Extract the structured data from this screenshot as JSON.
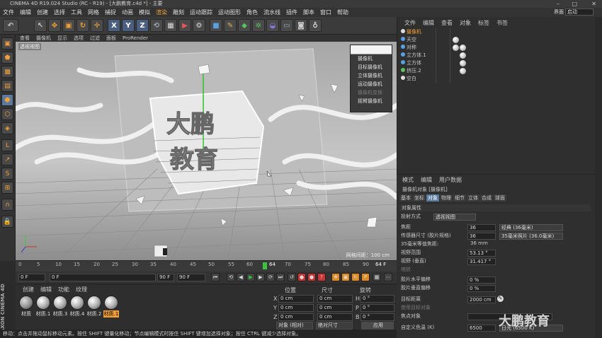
{
  "title_bar": {
    "text": "CINEMA 4D R19.024 Studio (RC - R19) - [大鹏教育.c4d *] - 主要",
    "min": "–",
    "max": "□",
    "close": "✕"
  },
  "menu": {
    "items": [
      "文件",
      "编辑",
      "创建",
      "选择",
      "工具",
      "网格",
      "捕捉",
      "动画",
      "模拟",
      "渲染",
      "雕刻",
      "运动跟踪",
      "运动图形",
      "角色",
      "流水线",
      "插件",
      "脚本",
      "窗口",
      "帮助"
    ],
    "layout_label": "界面",
    "layout_value": "启动"
  },
  "toolbar": {
    "undo": "↶",
    "x": "X",
    "y": "Y",
    "z": "Z"
  },
  "viewport": {
    "menu": [
      "查看",
      "摄像机",
      "显示",
      "选项",
      "过滤",
      "面板",
      "ProRender"
    ],
    "label": "透视视图",
    "grid_label": "网格间距：100 cm",
    "camera_menu": [
      {
        "label": "摄像机",
        "disabled": false
      },
      {
        "label": "目标摄像机",
        "disabled": false
      },
      {
        "label": "立体摄像机",
        "disabled": false
      },
      {
        "label": "运动摄像机",
        "disabled": false
      },
      {
        "label": "摄像机变换",
        "disabled": true
      },
      {
        "label": "摇臂摄像机",
        "disabled": false
      }
    ],
    "logo_line1": "大鹏",
    "logo_line2": "教育"
  },
  "timeline": {
    "ticks": [
      "0",
      "5",
      "10",
      "15",
      "20",
      "25",
      "30",
      "35",
      "40",
      "45",
      "50",
      "55",
      "60",
      "64",
      "70",
      "75",
      "80",
      "85",
      "90"
    ],
    "current": "64 F"
  },
  "framebar": {
    "start": "0 F",
    "start2": "0 F",
    "end": "90 F",
    "end2": "90 F"
  },
  "materials": {
    "menu": [
      "创建",
      "编辑",
      "功能",
      "纹理"
    ],
    "items": [
      "材质",
      "材质.1",
      "材质.3",
      "材质.4",
      "材质.2",
      "材质.1"
    ],
    "selected_index": 5
  },
  "brand": "MAXON CINEMA 4D",
  "coords": {
    "headers": [
      "位置",
      "尺寸",
      "旋转"
    ],
    "rows": [
      {
        "axis": "X",
        "pos": "0 cm",
        "size": "0 cm",
        "rot_axis": "H",
        "rot": "0 °"
      },
      {
        "axis": "Y",
        "pos": "0 cm",
        "size": "0 cm",
        "rot_axis": "P",
        "rot": "0 °"
      },
      {
        "axis": "Z",
        "pos": "0 cm",
        "size": "0 cm",
        "rot_axis": "B",
        "rot": "0 °"
      }
    ],
    "mode": "对象 (相对)",
    "size_mode": "绝对尺寸",
    "apply": "应用"
  },
  "status": "移动：点击并拖动鼠标移动元素。按住 SHIFT 键量化移动；节点编辑模式时按住 SHIFT 键增加选择对象；按住 CTRL 键减少选择对象。",
  "objects": {
    "menu": [
      "文件",
      "编辑",
      "查看",
      "对象",
      "标签",
      "书签"
    ],
    "rows": [
      {
        "name": "摄像机",
        "color": "#d8d8d8",
        "level": 0,
        "selected": true
      },
      {
        "name": "天空",
        "color": "#5aa0e0",
        "level": 0,
        "selected": false
      },
      {
        "name": "对称",
        "color": "#5aa0e0",
        "level": 0,
        "selected": false
      },
      {
        "name": "立方体.1",
        "color": "#5aa0e0",
        "level": 0,
        "selected": false
      },
      {
        "name": "立方体",
        "color": "#5aa0e0",
        "level": 0,
        "selected": false
      },
      {
        "name": "挤压.2",
        "color": "#59c25a",
        "level": 0,
        "selected": false
      },
      {
        "name": "空白",
        "color": "#d8d8d8",
        "level": 0,
        "selected": false
      }
    ]
  },
  "attributes": {
    "menu": [
      "模式",
      "编辑",
      "用户数据"
    ],
    "title": "摄像机对象 [摄像机]",
    "tabs": [
      "基本",
      "坐标",
      "对象",
      "物理",
      "细节",
      "立体",
      "合成",
      "球面"
    ],
    "active_tab": 2,
    "section": "对象属性",
    "rows": [
      {
        "label": "投射方式",
        "value": "透视视图",
        "type": "drop"
      },
      {
        "label": "焦距",
        "value": "36",
        "extra": "经典 (36毫米)",
        "type": "num"
      },
      {
        "label": "传感器尺寸 (胶片规格)",
        "value": "36",
        "extra": "35毫米照片 (36.0毫米)",
        "type": "num"
      },
      {
        "label": "35毫米等值焦距:",
        "value": "36 mm",
        "type": "text"
      },
      {
        "label": "视野范围",
        "value": "53.13 °",
        "type": "num"
      },
      {
        "label": "视野 (垂直)",
        "value": "31.417 °",
        "type": "num"
      },
      {
        "label": "缩放",
        "value": "1",
        "type": "dis"
      },
      {
        "label": "胶片水平偏移",
        "value": "0 %",
        "type": "num"
      },
      {
        "label": "胶片垂直偏移",
        "value": "0 %",
        "type": "num"
      },
      {
        "label": "目标距离",
        "value": "2000 cm",
        "type": "num"
      },
      {
        "label": "使用目标对象",
        "value": "",
        "type": "dis"
      },
      {
        "label": "焦点对象",
        "value": "",
        "type": "field"
      },
      {
        "label": "自定义色温 (K)",
        "value": "6500",
        "extra": "日光 (6500 K)",
        "type": "num"
      }
    ]
  },
  "watermark": "大鹏教育"
}
